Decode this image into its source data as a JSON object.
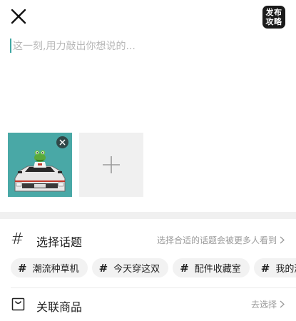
{
  "header": {
    "close_icon": "close-icon",
    "publish_label_line1": "发布",
    "publish_label_line2": "攻略"
  },
  "editor": {
    "placeholder": "这一刻,用力敲出你想说的..."
  },
  "media": {
    "remove_icon": "close-icon",
    "add_icon": "plus-icon"
  },
  "topic": {
    "icon": "hash-icon",
    "title": "选择话题",
    "hint": "选择合适的话题会被更多人看到",
    "tags": [
      {
        "label": "潮流种草机"
      },
      {
        "label": "今天穿这双"
      },
      {
        "label": "配件收藏室"
      },
      {
        "label": "我的潮玩"
      }
    ]
  },
  "goods": {
    "icon": "shopping-bag-icon",
    "title": "关联商品",
    "hint": "去选择"
  },
  "colors": {
    "accent": "#3fa7a2",
    "publish_bg": "#1b1b1b",
    "photo_bg": "#49a8a6"
  }
}
